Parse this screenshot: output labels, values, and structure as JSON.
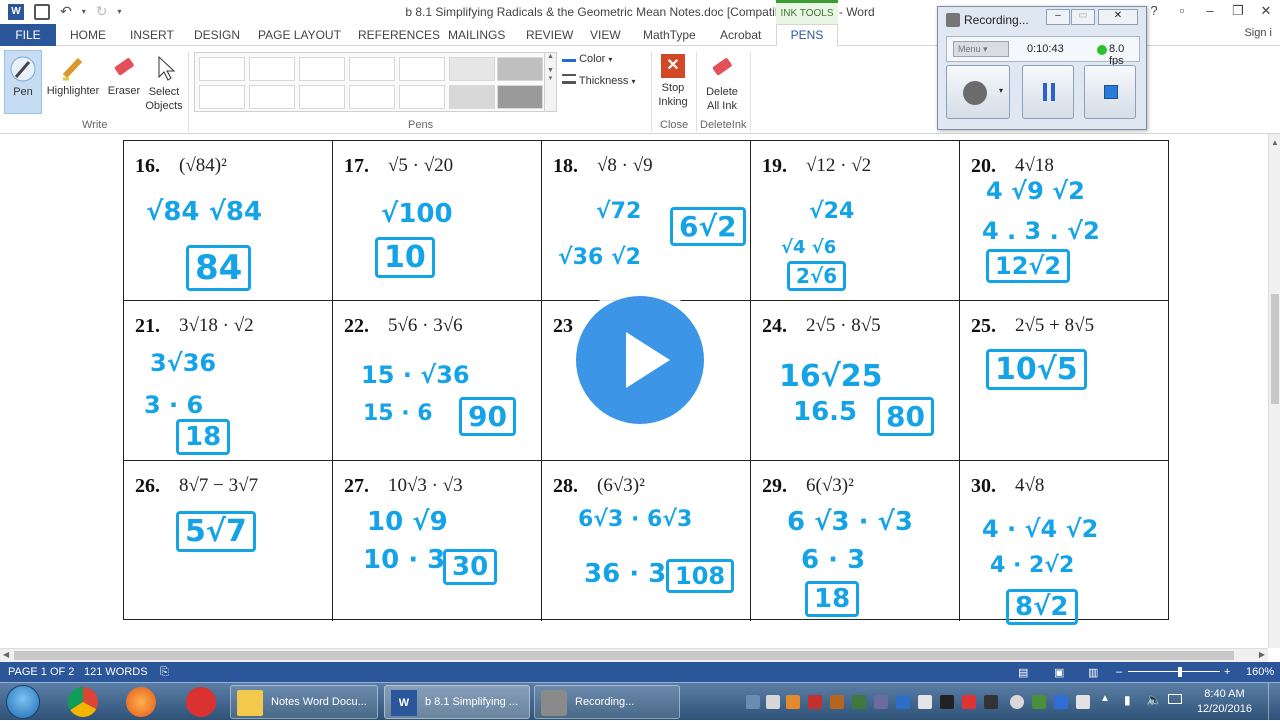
{
  "window": {
    "title": "b 8.1 Simplifying Radicals & the Geometric Mean Notes.doc [Compatibility Mode] - Word",
    "context_tab": "INK TOOLS",
    "sign_in": "Sign i"
  },
  "tabs": [
    "FILE",
    "HOME",
    "INSERT",
    "DESIGN",
    "PAGE LAYOUT",
    "REFERENCES",
    "MAILINGS",
    "REVIEW",
    "VIEW",
    "MathType",
    "Acrobat",
    "PENS"
  ],
  "ribbon": {
    "write_group": {
      "label": "Write",
      "pen": "Pen",
      "highlighter": "Highlighter",
      "eraser": "Eraser",
      "select_objects": "Select Objects"
    },
    "pens_group": {
      "label": "Pens",
      "color": "Color",
      "thickness": "Thickness"
    },
    "close_group": {
      "label": "Close",
      "stop_inking": "Stop Inking"
    },
    "delete_group": {
      "label": "DeleteInk",
      "delete_all_ink": "Delete All Ink"
    }
  },
  "recorder": {
    "title": "Recording...",
    "menu": "Menu",
    "time": "0:10:43",
    "fps": "8.0 fps"
  },
  "problems": [
    {
      "num": "16.",
      "expr": "(√84)²",
      "work": [
        "√84 √84"
      ],
      "answer": "84"
    },
    {
      "num": "17.",
      "expr": "√5 · √20",
      "work": [
        "√100"
      ],
      "answer": "10"
    },
    {
      "num": "18.",
      "expr": "√8 · √9",
      "work": [
        "√72",
        "√36 √2"
      ],
      "answer": "6√2"
    },
    {
      "num": "19.",
      "expr": "√12 · √2",
      "work": [
        "√24",
        "√4 √6"
      ],
      "answer": "2√6"
    },
    {
      "num": "20.",
      "expr": "4√18",
      "work": [
        "4 √9 √2",
        "4 . 3 . √2"
      ],
      "answer": "12√2"
    },
    {
      "num": "21.",
      "expr": "3√18 · √2",
      "work": [
        "3√36",
        "3 · 6"
      ],
      "answer": "18"
    },
    {
      "num": "22.",
      "expr": "5√6 · 3√6",
      "work": [
        "15 · √36",
        "15 · 6"
      ],
      "answer": "90"
    },
    {
      "num": "23",
      "expr": "",
      "work": [],
      "answer": ""
    },
    {
      "num": "24.",
      "expr": "2√5 · 8√5",
      "work": [
        "16√25",
        "16.5"
      ],
      "answer": "80"
    },
    {
      "num": "25.",
      "expr": "2√5 + 8√5",
      "work": [],
      "answer": "10√5"
    },
    {
      "num": "26.",
      "expr": "8√7 − 3√7",
      "work": [],
      "answer": "5√7"
    },
    {
      "num": "27.",
      "expr": "10√3 · √3",
      "work": [
        "10 √9",
        "10 · 3"
      ],
      "answer": "30"
    },
    {
      "num": "28.",
      "expr": "(6√3)²",
      "work": [
        "6√3 · 6√3",
        "36 · 3"
      ],
      "answer": "108"
    },
    {
      "num": "29.",
      "expr": "6(√3)²",
      "work": [
        "6  √3 · √3",
        "6 · 3"
      ],
      "answer": "18"
    },
    {
      "num": "30.",
      "expr": "4√8",
      "work": [
        "4 · √4 √2",
        "4 · 2√2"
      ],
      "answer": "8√2"
    }
  ],
  "statusbar": {
    "page": "PAGE 1 OF 2",
    "words": "121 WORDS",
    "zoom": "160%"
  },
  "taskbar": {
    "windows": [
      "Notes Word Docu...",
      "b 8.1 Simplifying ...",
      "Recording..."
    ],
    "time": "8:40 AM",
    "date": "12/20/2016"
  },
  "colors": {
    "ink": "#14a3e6",
    "word_blue": "#2b579a",
    "ink_tools_green": "#3c9b33",
    "play_blue": "#3d95e8"
  }
}
